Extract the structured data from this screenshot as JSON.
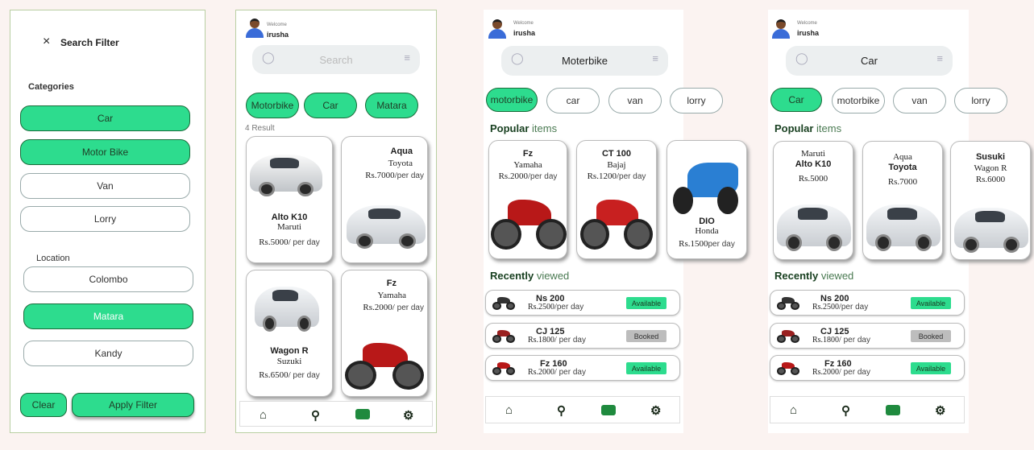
{
  "filter": {
    "close_icon": "×",
    "title": "Search Filter",
    "categories_label": "Categories",
    "categories": [
      "Car",
      "Motor Bike",
      "Van",
      "Lorry"
    ],
    "location_label": "Location",
    "locations": [
      "Colombo",
      "Matara",
      "Kandy"
    ],
    "clear": "Clear",
    "apply": "Apply Filter"
  },
  "screen2": {
    "welcome": "Welcome",
    "user": "irusha",
    "search_placeholder": "Search",
    "chips": [
      "Motorbike",
      "Car",
      "Matara"
    ],
    "result_count": "4 Result",
    "cards": [
      {
        "l1": "Alto K10",
        "l2": "Maruti",
        "price": "Rs.5000/",
        "unit": " per day"
      },
      {
        "l1": "Aqua",
        "l2": "Toyota",
        "price": "Rs.7000/",
        "unit": "per day"
      },
      {
        "l1": "Wagon R",
        "l2": "Suzuki",
        "price": "Rs.6500/",
        "unit": " per day"
      },
      {
        "l1": "Fz",
        "l2": "Yamaha",
        "price": "Rs.2000/",
        "unit": " per day"
      }
    ]
  },
  "screen3": {
    "welcome": "Welcome",
    "user": "irusha",
    "search_value": "Moterbike",
    "chips": [
      "motorbike",
      "car",
      "van",
      "lorry"
    ],
    "popular_bold": "Popular",
    "popular_rest": " items",
    "popular": [
      {
        "l1": "Fz",
        "l2": "Yamaha",
        "price": "Rs.2000/",
        "unit": "per day"
      },
      {
        "l1": "CT 100",
        "l2": "Bajaj",
        "price": "Rs.1200/",
        "unit": "per day"
      },
      {
        "l1": "DIO",
        "l2": "Honda",
        "price": "Rs.1500",
        "unit": "per day"
      }
    ],
    "recent_bold": "Recently",
    "recent_rest": " viewed",
    "recent": [
      {
        "name": "Ns 200",
        "price": "Rs.2500/",
        "unit": "per day",
        "status": "Available"
      },
      {
        "name": "CJ 125",
        "price": "Rs.1800/",
        "unit": " per day",
        "status": "Booked"
      },
      {
        "name": "Fz 160",
        "price": "Rs.2000/",
        "unit": " per day",
        "status": "Available"
      }
    ]
  },
  "screen4": {
    "welcome": "Welcome",
    "user": "irusha",
    "search_value": "Car",
    "chips": [
      "Car",
      "motorbike",
      "van",
      "lorry"
    ],
    "popular_bold": "Popular",
    "popular_rest": " items",
    "popular": [
      {
        "l1": "Maruti",
        "l2": "Alto K10",
        "price": "Rs.5000"
      },
      {
        "l1": "Aqua",
        "l2": "Toyota",
        "price": "Rs.7000"
      },
      {
        "l1": "Susuki",
        "l2": "Wagon R",
        "price": "Rs.6000"
      }
    ],
    "recent_bold": "Recently",
    "recent_rest": " viewed",
    "recent": [
      {
        "name": "Ns 200",
        "price": "Rs.2500/",
        "unit": "per day",
        "status": "Available"
      },
      {
        "name": "CJ 125",
        "price": "Rs.1800/",
        "unit": " per day",
        "status": "Booked"
      },
      {
        "name": "Fz 160",
        "price": "Rs.2000/",
        "unit": " per day",
        "status": "Available"
      }
    ]
  },
  "nav_icons": [
    "home-icon",
    "search-icon",
    "chat-icon",
    "settings-icon"
  ],
  "colors": {
    "accent": "#2ddc8e",
    "dark_green": "#173f1f"
  }
}
